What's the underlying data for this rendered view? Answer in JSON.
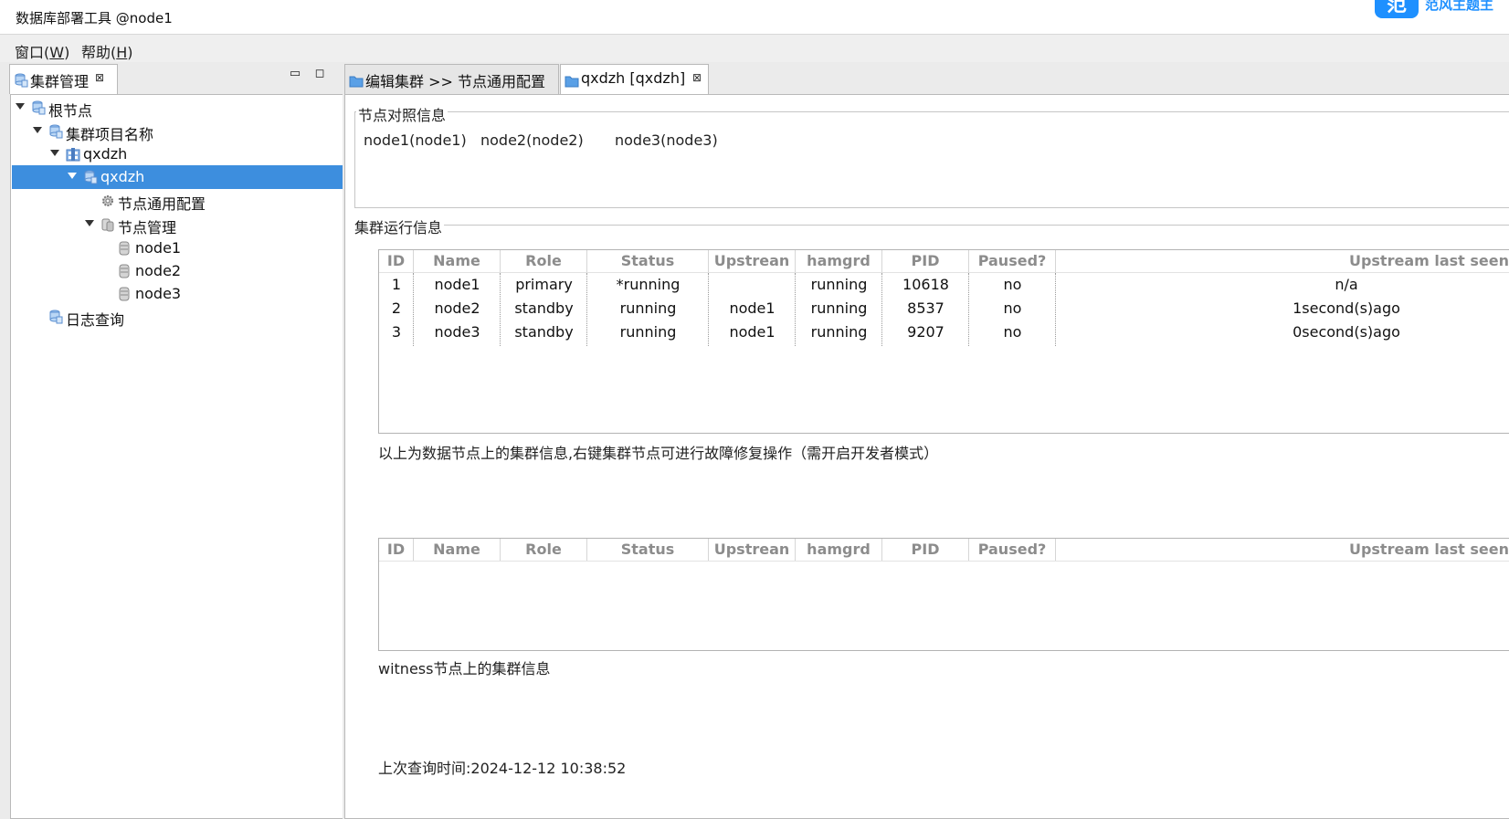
{
  "window": {
    "title": "数据库部署工具 @node1"
  },
  "badge": {
    "icon": "app-badge-icon",
    "text": "范",
    "partial_label": "范风主题主"
  },
  "menu": [
    {
      "label": "窗口(W)",
      "pre": "窗口(",
      "key": "W",
      "post": ")"
    },
    {
      "label": "帮助(H)",
      "pre": "帮助(",
      "key": "H",
      "post": ")"
    }
  ],
  "left_view": {
    "tab_label": "集群管理",
    "tab_close": "⊠",
    "minimize": "▭",
    "maximize": "◻",
    "tree": [
      {
        "label": "根节点",
        "icon": "database-icon",
        "expanded": true
      },
      {
        "label": "集群项目名称",
        "icon": "database-icon",
        "expanded": true
      },
      {
        "label": "qxdzh",
        "icon": "building-icon",
        "expanded": true
      },
      {
        "label": "qxdzh",
        "icon": "database-icon",
        "expanded": true,
        "selected": true
      },
      {
        "label": "节点通用配置",
        "icon": "gear-icon"
      },
      {
        "label": "节点管理",
        "icon": "server-icon",
        "expanded": true
      },
      {
        "label": "node1",
        "icon": "db-node-icon"
      },
      {
        "label": "node2",
        "icon": "db-node-icon"
      },
      {
        "label": "node3",
        "icon": "db-node-icon"
      },
      {
        "label": "日志查询",
        "icon": "database-icon"
      }
    ]
  },
  "editor_tabs": [
    {
      "label": "编辑集群 >> 节点通用配置",
      "icon": "folder-icon",
      "active": false
    },
    {
      "label": "qxdzh [qxdzh]",
      "icon": "folder-icon",
      "active": true,
      "close": "⊠"
    }
  ],
  "node_group": {
    "title": "节点对照信息",
    "nodes": [
      "node1(node1)",
      "node2(node2)",
      "node3(node3)"
    ]
  },
  "run_group": {
    "title": "集群运行信息",
    "columns": [
      "ID",
      "Name",
      "Role",
      "Status",
      "Upstrean",
      "hamgrd",
      "PID",
      "Paused?",
      "Upstream last seen"
    ],
    "rows": [
      [
        "1",
        "node1",
        "primary",
        "*running",
        "",
        "running",
        "10618",
        "no",
        "n/a"
      ],
      [
        "2",
        "node2",
        "standby",
        "running",
        "node1",
        "running",
        "8537",
        "no",
        "1second(s)ago"
      ],
      [
        "3",
        "node3",
        "standby",
        "running",
        "node1",
        "running",
        "9207",
        "no",
        "0second(s)ago"
      ]
    ],
    "data_caption": "以上为数据节点上的集群信息,右键集群节点可进行故障修复操作（需开启开发者模式）",
    "witness_columns": [
      "ID",
      "Name",
      "Role",
      "Status",
      "Upstrean",
      "hamgrd",
      "PID",
      "Paused?",
      "Upstream last seen"
    ],
    "witness_rows": [],
    "witness_caption": "witness节点上的集群信息",
    "last_query": "上次查询时间:2024-12-12 10:38:52"
  }
}
